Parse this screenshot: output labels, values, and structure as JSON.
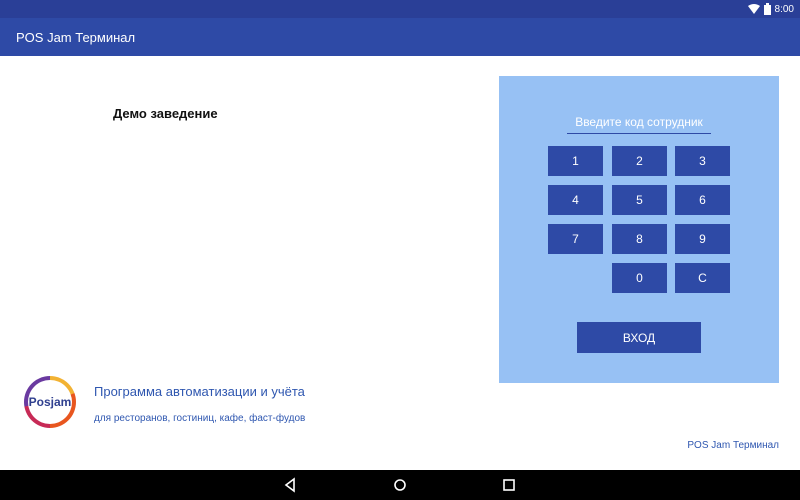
{
  "status": {
    "time": "8:00",
    "wifi_icon": "wifi-icon",
    "battery_icon": "battery-icon"
  },
  "app": {
    "title": "POS Jam Терминал"
  },
  "venue": {
    "name": "Демо заведение"
  },
  "login": {
    "code_placeholder": "Введите код сотрудник",
    "keys": [
      "1",
      "2",
      "3",
      "4",
      "5",
      "6",
      "7",
      "8",
      "9",
      "0",
      "C"
    ],
    "enter_label": "ВХОД"
  },
  "brand": {
    "logo_text": "Posjam",
    "tagline": "Программа автоматизации и учёта",
    "subtitle": "для ресторанов, гостиниц, кафе, фаст-фудов"
  },
  "footer": {
    "app_name": "POS Jam Терминал"
  },
  "colors": {
    "appbar": "#2e4aa6",
    "statusbar": "#2a3f97",
    "panel": "#97c1f4",
    "button": "#2e4aa6",
    "text_link": "#2f57b0"
  },
  "navigation": {
    "back_icon": "back-icon",
    "home_icon": "home-icon",
    "recents_icon": "recents-icon"
  }
}
